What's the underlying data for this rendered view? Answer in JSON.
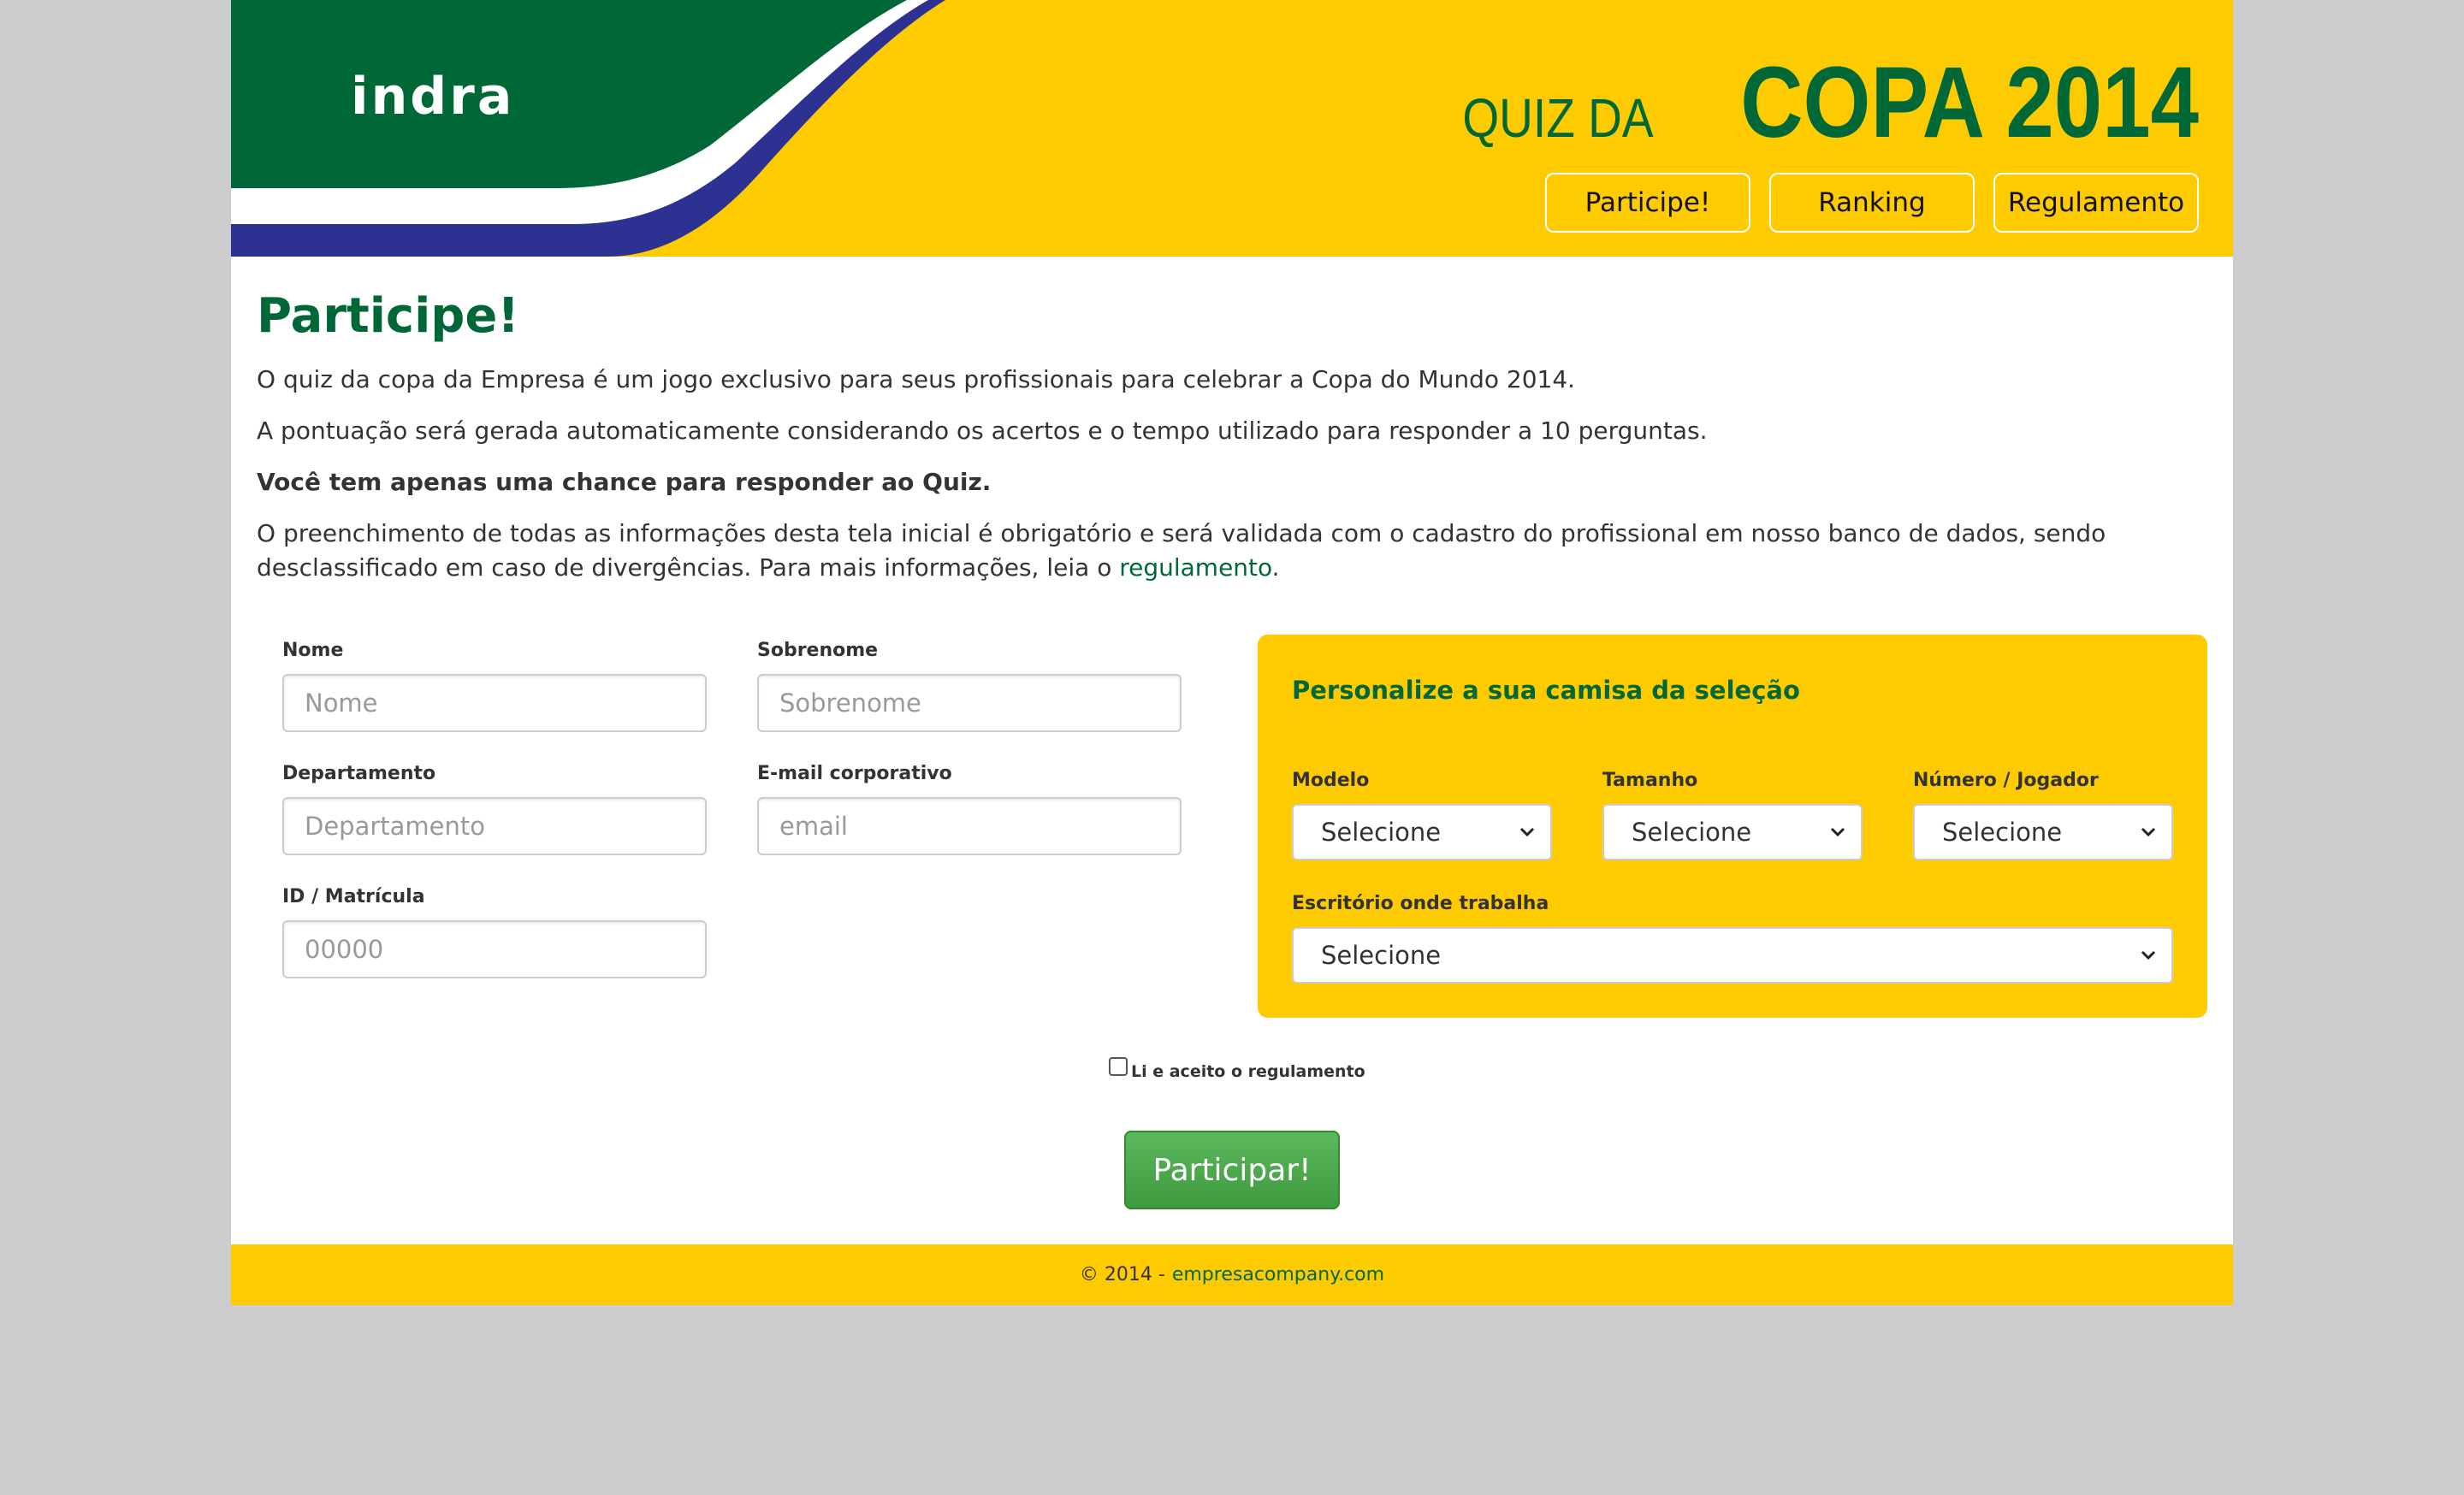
{
  "header": {
    "logo_text": "indra",
    "title_small": "QUIZ DA",
    "title_big": "COPA 2014",
    "nav": [
      "Participe!",
      "Ranking",
      "Regulamento"
    ]
  },
  "intro": {
    "heading": "Participe!",
    "p1": "O quiz da copa da Empresa é um jogo exclusivo para seus profissionais para celebrar a Copa do Mundo 2014.",
    "p2": "A pontuação será gerada automaticamente considerando os acertos e o tempo utilizado para responder a 10 perguntas.",
    "p3": "Você tem apenas uma chance para responder ao Quiz.",
    "p4_before": "O preenchimento de todas as informações desta tela inicial é obrigatório e será validada com o cadastro do profissional em nosso banco de dados, sendo desclassificado em caso de divergências. Para mais informações, leia o ",
    "p4_link": "regulamento",
    "p4_after": "."
  },
  "form": {
    "nome": {
      "label": "Nome",
      "placeholder": "Nome"
    },
    "sobrenome": {
      "label": "Sobrenome",
      "placeholder": "Sobrenome"
    },
    "departamento": {
      "label": "Departamento",
      "placeholder": "Departamento"
    },
    "email": {
      "label": "E-mail corporativo",
      "placeholder": "email"
    },
    "id": {
      "label": "ID / Matrícula",
      "placeholder": "00000"
    }
  },
  "panel": {
    "title": "Personalize a sua camisa da seleção",
    "modelo": {
      "label": "Modelo",
      "value": "Selecione"
    },
    "tamanho": {
      "label": "Tamanho",
      "value": "Selecione"
    },
    "numero": {
      "label": "Número / Jogador",
      "value": "Selecione"
    },
    "escritorio": {
      "label": "Escritório onde trabalha",
      "value": "Selecione"
    }
  },
  "accept": {
    "label": "Li e aceito o regulamento",
    "checked": false
  },
  "submit_label": "Participar!",
  "footer": {
    "copyright": "© 2014 -",
    "link": "empresacompany.com"
  },
  "colors": {
    "brand_green": "#006837",
    "brand_yellow": "#fecb00",
    "brand_blue": "#2d3192",
    "button_green": "#4cae4c"
  }
}
